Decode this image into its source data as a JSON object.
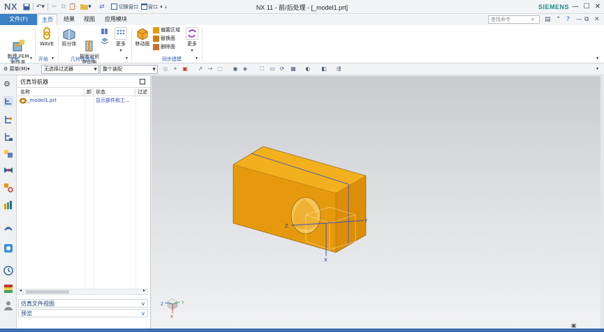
{
  "app": {
    "logo": "NX",
    "title": "NX 11 - 前/后处理 - [_model1.prt]",
    "brand": "SIEMENS",
    "switch_window_label": "切换窗口",
    "window_label": "窗口"
  },
  "tabs": {
    "file": "文件(F)",
    "items": [
      "主页",
      "结果",
      "视图",
      "应用模块"
    ]
  },
  "search": {
    "placeholder": "查找命令"
  },
  "ribbon": {
    "new_fem": "新建 FEM\n和仿真",
    "wave": "WAVE",
    "split_body": "拆分体",
    "mid_surface": "按面对创\n建中面",
    "more1": "更多",
    "move_face": "移动面",
    "offset_region": "偏置区域",
    "replace_face": "替换面",
    "delete_face": "删除面",
    "more2": "更多",
    "groups": {
      "association": "关联",
      "start": "开始",
      "geometry_prep": "几何体准备",
      "sync_modeling": "同步建模"
    }
  },
  "filterbar": {
    "menu": "菜单(M)",
    "selection_filter": "无选择过滤器",
    "assembly": "整个装配"
  },
  "navigator": {
    "title": "仿真导航器",
    "columns": [
      "名称",
      "颜",
      "状态",
      "过滤"
    ],
    "rows": [
      {
        "name": "_model1.prt",
        "status": "显示部件和工..."
      }
    ],
    "sections": [
      "仿真文件视图",
      "预览"
    ]
  },
  "viewport": {
    "axis_x": "X",
    "axis_y": "Y",
    "axis_z": "Z",
    "triad_x": "X",
    "triad_y": "Y",
    "triad_z": "Z"
  },
  "colors": {
    "accent": "#3b7fc4",
    "part_front": "#e59a0d",
    "part_top": "#f2b01e",
    "part_side": "#d98806",
    "edge": "#4a5fb4"
  }
}
